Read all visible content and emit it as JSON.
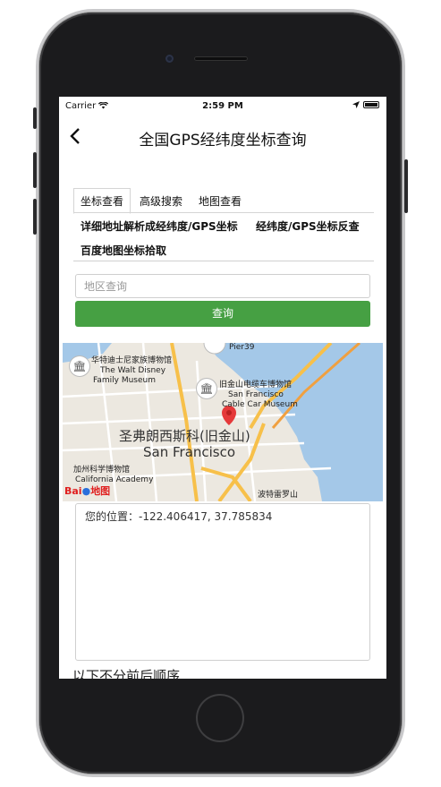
{
  "status_bar": {
    "carrier": "Carrier",
    "time": "2:59 PM"
  },
  "navbar": {
    "back_icon": "chevron-left-icon",
    "title": "全国GPS经纬度坐标查询"
  },
  "tabs": [
    {
      "label": "坐标查看",
      "active": true
    },
    {
      "label": "高级搜索",
      "active": false
    },
    {
      "label": "地图查看",
      "active": false
    }
  ],
  "sub_links": {
    "row1_left": "详细地址解析成经纬度/GPS坐标",
    "row1_right": "经纬度/GPS坐标反查",
    "row2": "百度地图坐标拾取"
  },
  "search": {
    "placeholder": "地区查询",
    "value": "",
    "button_label": "查询"
  },
  "map": {
    "labels": {
      "disney_cn": "华特迪士尼家族博物馆",
      "disney_en1": "The Walt Disney",
      "disney_en2": "Family Museum",
      "cable_cn": "旧金山电缆车博物馆",
      "cable_en1": "San Francisco",
      "cable_en2": "Cable Car Museum",
      "pier": "Pier39",
      "city_cn": "圣弗朗西斯科(旧金山)",
      "city_en": "San Francisco",
      "academy_cn": "加州科学博物馆",
      "academy_en": "California Academy",
      "boston": "波特雷罗山",
      "logo_text": "Bai",
      "logo_text2": "地图"
    },
    "colors": {
      "water": "#a4c8e8",
      "land": "#ece8e0",
      "road_major": "#f7c04a",
      "marker": "#e5393a"
    }
  },
  "result": {
    "text": "您的位置：-122.406417, 37.785834"
  },
  "footer": {
    "text": "以下不分前后顺序"
  },
  "colors": {
    "accent_green": "#46a043"
  }
}
